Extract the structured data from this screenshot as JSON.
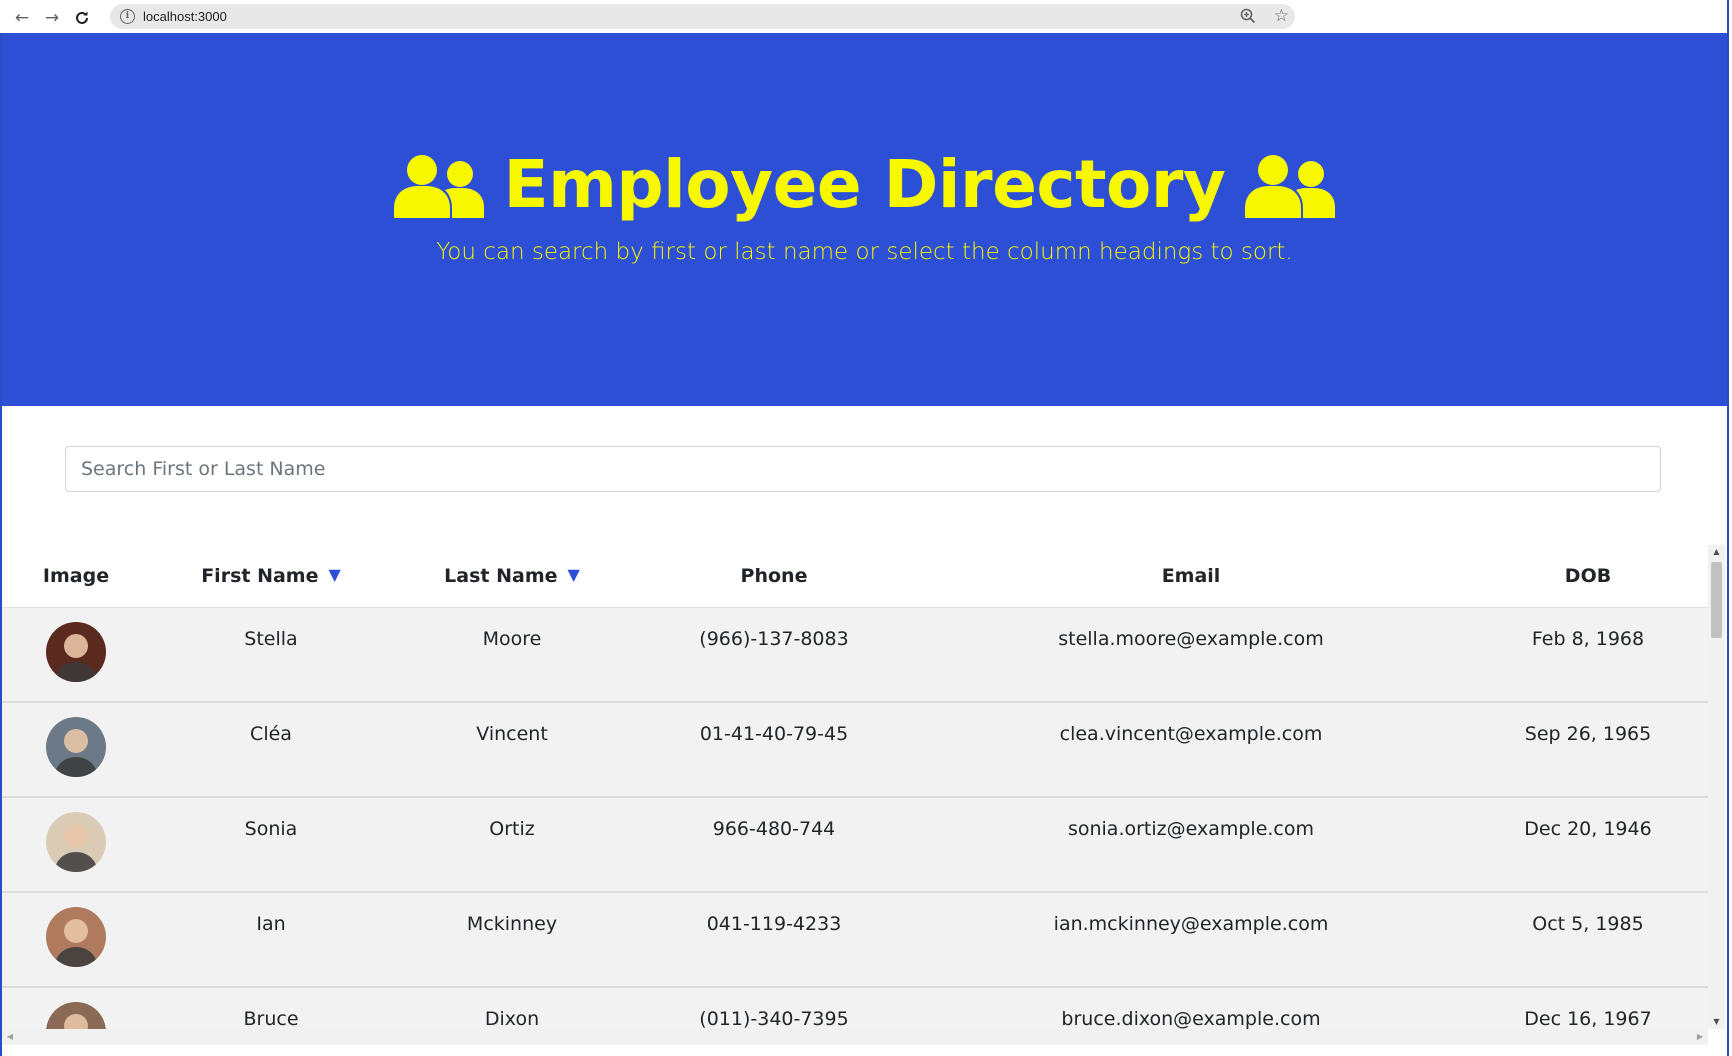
{
  "browser": {
    "url": "localhost:3000"
  },
  "header": {
    "title": "Employee Directory",
    "subtitle": "You can search by first or last name or select the column headings to sort.",
    "icon": "users-icon",
    "background_color": "#2d4fd6",
    "text_color": "#f7f700"
  },
  "search": {
    "placeholder": "Search First or Last Name",
    "value": ""
  },
  "table": {
    "columns": [
      {
        "label": "Image",
        "sortable": false
      },
      {
        "label": "First Name",
        "sortable": true,
        "arrow": "▼"
      },
      {
        "label": "Last Name",
        "sortable": true,
        "arrow": "▼"
      },
      {
        "label": "Phone",
        "sortable": false
      },
      {
        "label": "Email",
        "sortable": false
      },
      {
        "label": "DOB",
        "sortable": false
      }
    ],
    "rows": [
      {
        "first": "Stella",
        "last": "Moore",
        "phone": "(966)-137-8083",
        "email": "stella.moore@example.com",
        "dob": "Feb 8, 1968",
        "avatar_color": "#5a2a1f"
      },
      {
        "first": "Cléa",
        "last": "Vincent",
        "phone": "01-41-40-79-45",
        "email": "clea.vincent@example.com",
        "dob": "Sep 26, 1965",
        "avatar_color": "#6b7a86"
      },
      {
        "first": "Sonia",
        "last": "Ortiz",
        "phone": "966-480-744",
        "email": "sonia.ortiz@example.com",
        "dob": "Dec 20, 1946",
        "avatar_color": "#d9cbb5"
      },
      {
        "first": "Ian",
        "last": "Mckinney",
        "phone": "041-119-4233",
        "email": "ian.mckinney@example.com",
        "dob": "Oct 5, 1985",
        "avatar_color": "#b07a5e"
      },
      {
        "first": "Bruce",
        "last": "Dixon",
        "phone": "(011)-340-7395",
        "email": "bruce.dixon@example.com",
        "dob": "Dec 16, 1967",
        "avatar_color": "#8a6a55"
      }
    ]
  }
}
